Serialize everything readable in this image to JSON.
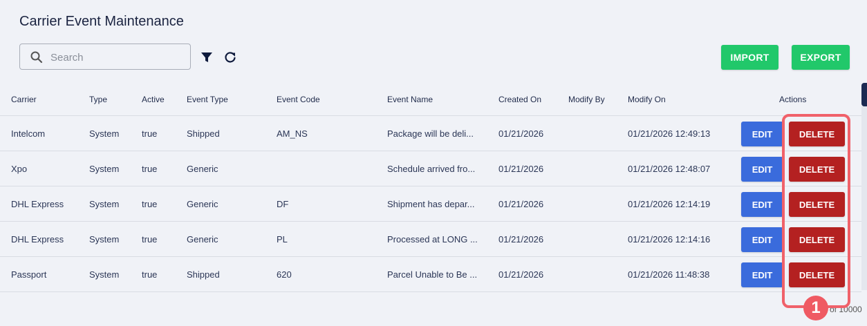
{
  "page": {
    "title": "Carrier Event Maintenance"
  },
  "search": {
    "placeholder": "Search",
    "value": ""
  },
  "toolbar": {
    "import_label": "IMPORT",
    "export_label": "EXPORT",
    "green": "#21c86a"
  },
  "table": {
    "columns": [
      "Carrier",
      "Type",
      "Active",
      "Event Type",
      "Event Code",
      "Event Name",
      "Created On",
      "Modify By",
      "Modify On",
      "Actions"
    ],
    "rows": [
      {
        "carrier": "Intelcom",
        "type": "System",
        "active": "true",
        "event_type": "Shipped",
        "event_code": "AM_NS",
        "event_name": "Package will be deli...",
        "created_on": "01/21/2026",
        "modify_by": "",
        "modify_on": "01/21/2026 12:49:13"
      },
      {
        "carrier": "Xpo",
        "type": "System",
        "active": "true",
        "event_type": "Generic",
        "event_code": "",
        "event_name": "Schedule arrived fro...",
        "created_on": "01/21/2026",
        "modify_by": "",
        "modify_on": "01/21/2026 12:48:07"
      },
      {
        "carrier": "DHL Express",
        "type": "System",
        "active": "true",
        "event_type": "Generic",
        "event_code": "DF",
        "event_name": "Shipment has depar...",
        "created_on": "01/21/2026",
        "modify_by": "",
        "modify_on": "01/21/2026 12:14:19"
      },
      {
        "carrier": "DHL Express",
        "type": "System",
        "active": "true",
        "event_type": "Generic",
        "event_code": "PL",
        "event_name": "Processed at LONG ...",
        "created_on": "01/21/2026",
        "modify_by": "",
        "modify_on": "01/21/2026 12:14:16"
      },
      {
        "carrier": "Passport",
        "type": "System",
        "active": "true",
        "event_type": "Shipped",
        "event_code": "620",
        "event_name": "Parcel Unable to Be ...",
        "created_on": "01/21/2026",
        "modify_by": "",
        "modify_on": "01/21/2026 11:48:38"
      }
    ],
    "edit_label": "EDIT",
    "delete_label": "DELETE",
    "edit_color": "#3a6bdc",
    "delete_color": "#b42121"
  },
  "annotation": {
    "marker": "1",
    "color": "#ef5a63"
  },
  "pagination": {
    "text": "of 10000"
  }
}
